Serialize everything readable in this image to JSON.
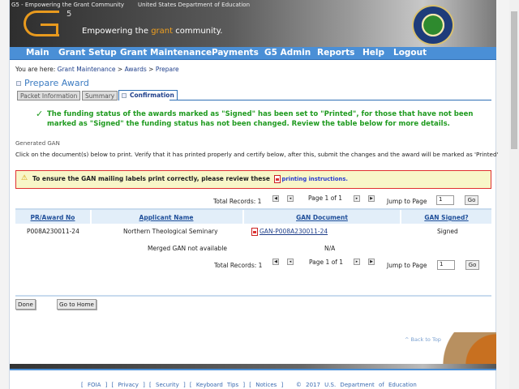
{
  "header": {
    "logo_alt": "G5 - Empowering the Grant Community",
    "dept_alt": "United States Department of Education",
    "logo_sup": "5",
    "tagline_pre": "Empowering the ",
    "tagline_accent": "grant",
    "tagline_post": " community."
  },
  "nav": [
    "Main",
    "Grant Setup",
    "Grant Maintenance",
    "Payments",
    "G5 Admin",
    "Reports",
    "Help",
    "Logout"
  ],
  "breadcrumb": {
    "prefix": "You are here: ",
    "items": [
      "Grant Maintenance",
      "Awards",
      "Prepare"
    ],
    "sep": " > "
  },
  "page_title": "Prepare Award",
  "tabs": [
    "Packet Information",
    "Summary",
    "Confirmation"
  ],
  "success_message": "The funding status of the awards marked as \"Signed\" has been set to \"Printed\", for those that have not been marked as \"Signed\" the funding status has not been changed. Review the table below for more details.",
  "section_label": "Generated GAN",
  "instructions": "Click on the document(s) below to print. Verify that it has printed properly and certify below, after this, submit the changes and the award will be marked as 'Printed'",
  "warning": {
    "text": "To ensure the GAN mailing labels print correctly, please review these ",
    "link": "printing instructions."
  },
  "pager": {
    "total": "Total Records: 1",
    "page": "Page 1 of 1",
    "jump_label": "Jump to Page",
    "jump_value": "1",
    "go": "Go"
  },
  "table": {
    "headers": [
      "PR/Award No",
      "Applicant Name",
      "GAN Document",
      "GAN Signed?"
    ],
    "rows": [
      {
        "award": "P008A230011-24",
        "applicant": "Northern Theological Seminary",
        "document": "GAN-P008A230011-24",
        "signed": "Signed"
      }
    ],
    "merged_label": "Merged GAN not available",
    "merged_value": "N/A"
  },
  "buttons": {
    "done": "Done",
    "home": "Go to Home"
  },
  "back_to_top": "^ Back to Top",
  "footer": {
    "links": [
      "FOIA",
      "Privacy",
      "Security",
      "Keyboard Tips",
      "Notices"
    ],
    "copyright": "© 2017 U.S. Department of Education"
  },
  "colors": {
    "nav": "#4a8fd6",
    "accent": "#f0a020",
    "success": "#1f9a1f",
    "warning_border": "#e03030"
  }
}
